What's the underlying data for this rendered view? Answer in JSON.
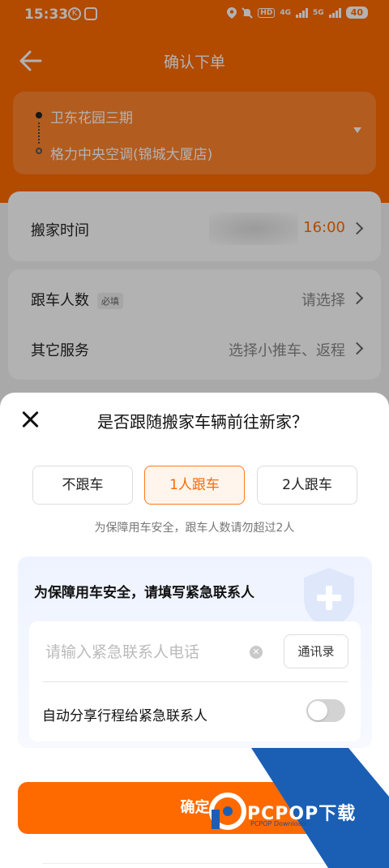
{
  "status_bar": {
    "time": "15:33",
    "k_icon": "K",
    "network_hd": "HD",
    "network_4g": "4G",
    "network_5g": "5G",
    "battery": "40",
    "icons": [
      "location-icon",
      "mute-icon",
      "signal-icon",
      "battery-icon"
    ]
  },
  "nav": {
    "title": "确认下单"
  },
  "address": {
    "from": "卫东花园三期",
    "to": "格力中央空调(锦城大厦店)"
  },
  "moving_time": {
    "label": "搬家时间",
    "value": "16:00"
  },
  "passengers": {
    "label": "跟车人数",
    "required_tag": "必填",
    "value": "请选择"
  },
  "other_services": {
    "label": "其它服务",
    "value": "选择小推车、返程"
  },
  "sheet": {
    "title": "是否跟随搬家车辆前往新家？",
    "options": [
      {
        "label": "不跟车",
        "selected": false
      },
      {
        "label": "1人跟车",
        "selected": true
      },
      {
        "label": "2人跟车",
        "selected": false
      }
    ],
    "note": "为保障用车安全，跟车人数请勿超过2人",
    "contact": {
      "title": "为保障用车安全，请填写紧急联系人",
      "phone_placeholder": "请输入紧急联系人电话",
      "phone_value": "",
      "contacts_button": "通讯录",
      "share_label": "自动分享行程给紧急联系人",
      "share_enabled": false
    },
    "confirm_button": "确定"
  },
  "watermark": {
    "text": "PCPOP下载",
    "sub": "PCPOP Download"
  },
  "colors": {
    "brand": "#ff6a00",
    "selected_bg": "#fff5ed",
    "panel_bg": "#eef3ff",
    "watermark_blue": "#1a5fb4"
  }
}
